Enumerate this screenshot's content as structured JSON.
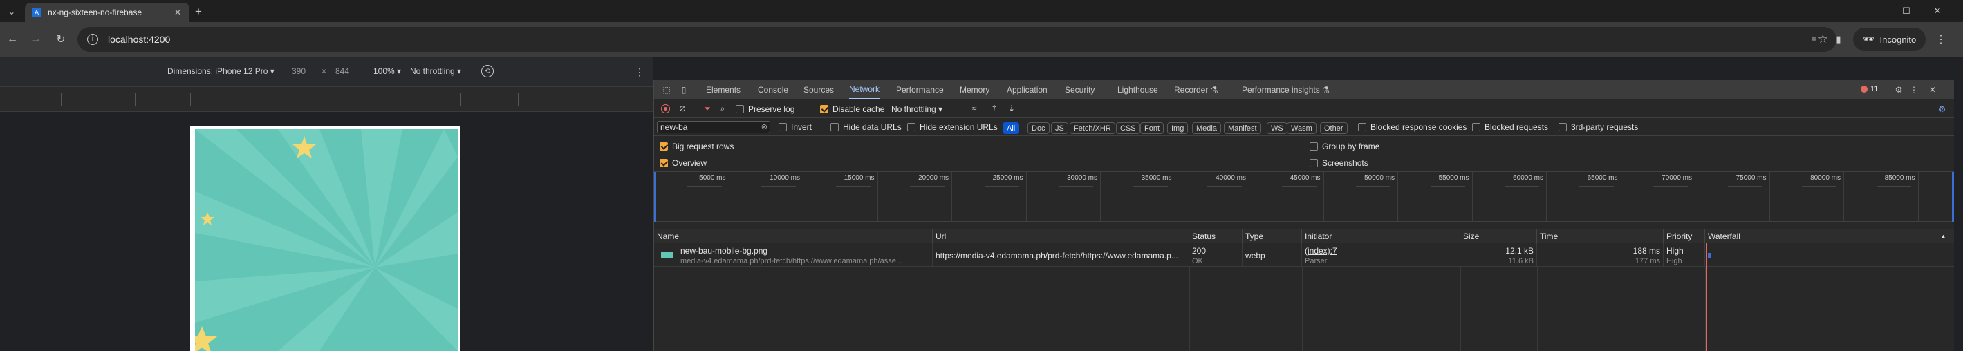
{
  "browser": {
    "tab_title": "nx-ng-sixteen-no-firebase",
    "url": "localhost:4200",
    "incognito_label": "Incognito"
  },
  "device_toolbar": {
    "dimensions_label": "Dimensions: iPhone 12 Pro",
    "width": "390",
    "times": "×",
    "height": "844",
    "zoom": "100%",
    "throttling": "No throttling"
  },
  "devtools": {
    "panels": [
      "Elements",
      "Console",
      "Sources",
      "Network",
      "Performance",
      "Memory",
      "Application",
      "Security",
      "Lighthouse",
      "Recorder",
      "Performance insights"
    ],
    "selected_panel": "Network",
    "issues_count": "11",
    "network_toolbar": {
      "preserve_log": "Preserve log",
      "disable_cache": "Disable cache",
      "throttling": "No throttling"
    },
    "filter": {
      "value": "new-ba",
      "invert": "Invert",
      "hide_data_urls": "Hide data URLs",
      "hide_extension_urls": "Hide extension URLs",
      "types": [
        "All",
        "Doc",
        "JS",
        "Fetch/XHR",
        "CSS",
        "Font",
        "Img",
        "Media",
        "Manifest",
        "WS",
        "Wasm",
        "Other"
      ],
      "selected_type": "All",
      "blocked_response_cookies": "Blocked response cookies",
      "blocked_requests": "Blocked requests",
      "third_party": "3rd-party requests"
    },
    "options": {
      "big_request_rows": "Big request rows",
      "overview": "Overview",
      "group_by_frame": "Group by frame",
      "screenshots": "Screenshots"
    },
    "timeline_ticks": [
      "5000 ms",
      "10000 ms",
      "15000 ms",
      "20000 ms",
      "25000 ms",
      "30000 ms",
      "35000 ms",
      "40000 ms",
      "45000 ms",
      "50000 ms",
      "55000 ms",
      "60000 ms",
      "65000 ms",
      "70000 ms",
      "75000 ms",
      "80000 ms",
      "85000 ms"
    ],
    "columns": [
      "Name",
      "Url",
      "Status",
      "Type",
      "Initiator",
      "Size",
      "Time",
      "Priority",
      "Waterfall"
    ],
    "requests": [
      {
        "name": "new-bau-mobile-bg.png",
        "path": "media-v4.edamama.ph/prd-fetch/https://www.edamama.ph/asse...",
        "url": "https://media-v4.edamama.ph/prd-fetch/https://www.edamama.p...",
        "status": "200",
        "status_text": "OK",
        "type": "webp",
        "initiator": "(index):7",
        "initiator_sub": "Parser",
        "size": "12.1 kB",
        "size_sub": "11.6 kB",
        "time": "188 ms",
        "time_sub": "177 ms",
        "priority": "High",
        "priority_sub": "High"
      }
    ]
  },
  "colors": {
    "accent": "#a8c7fa",
    "device_bg": "#62c5b6",
    "star": "#f5d76e",
    "checkbox": "#f5a83a"
  }
}
